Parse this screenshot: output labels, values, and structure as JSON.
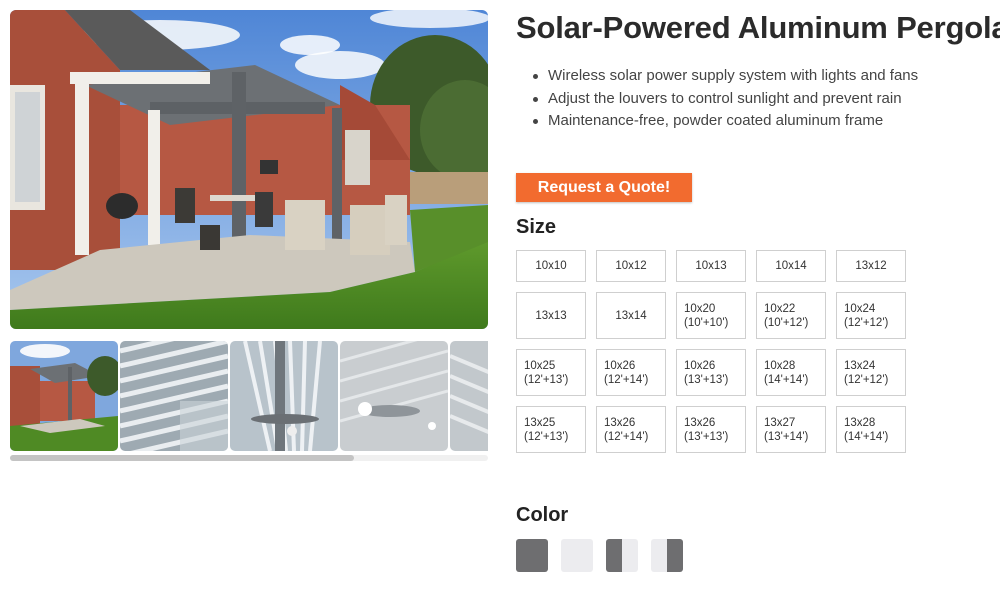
{
  "product": {
    "title": "Solar-Powered Aluminum Pergola",
    "features": [
      "Wireless solar power supply system with lights and fans",
      "Adjust the louvers to control sunlight and prevent rain",
      "Maintenance-free, powder coated aluminum frame"
    ],
    "quote_button": "Request a Quote!"
  },
  "gallery": {
    "main_image": "pergola-patio-photo",
    "thumbnails": [
      "patio-thumb",
      "louver-roof-thumb",
      "louver-fan-thumb",
      "ceiling-fan-light-thumb",
      "louver-side-thumb"
    ],
    "scroll_position": 0.72
  },
  "size": {
    "label": "Size",
    "options": [
      {
        "main": "10x10",
        "sub": ""
      },
      {
        "main": "10x12",
        "sub": ""
      },
      {
        "main": "10x13",
        "sub": ""
      },
      {
        "main": "10x14",
        "sub": ""
      },
      {
        "main": "13x12",
        "sub": ""
      },
      {
        "main": "13x13",
        "sub": ""
      },
      {
        "main": "13x14",
        "sub": ""
      },
      {
        "main": "10x20",
        "sub": "(10'+10')"
      },
      {
        "main": "10x22",
        "sub": "(10'+12')"
      },
      {
        "main": "10x24",
        "sub": "(12'+12')"
      },
      {
        "main": "10x25",
        "sub": "(12'+13')"
      },
      {
        "main": "10x26",
        "sub": "(12'+14')"
      },
      {
        "main": "10x26",
        "sub": "(13'+13')"
      },
      {
        "main": "10x28",
        "sub": "(14'+14')"
      },
      {
        "main": "13x24",
        "sub": "(12'+12')"
      },
      {
        "main": "13x25",
        "sub": "(12'+13')"
      },
      {
        "main": "13x26",
        "sub": "(12'+14')"
      },
      {
        "main": "13x26",
        "sub": "(13'+13')"
      },
      {
        "main": "13x27",
        "sub": "(13'+14')"
      },
      {
        "main": "13x28",
        "sub": "(14'+14')"
      }
    ]
  },
  "color": {
    "label": "Color",
    "swatches": [
      {
        "name": "gray-swatch",
        "left": "#6e6e70",
        "right": "#6e6e70"
      },
      {
        "name": "white-swatch",
        "left": "#ececef",
        "right": "#ececef"
      },
      {
        "name": "gray-white-swatch",
        "left": "#6e6e70",
        "right": "#ececef"
      },
      {
        "name": "white-gray-swatch",
        "left": "#ececef",
        "right": "#6e6e70"
      }
    ]
  },
  "colors": {
    "accent": "#f26b2f"
  }
}
